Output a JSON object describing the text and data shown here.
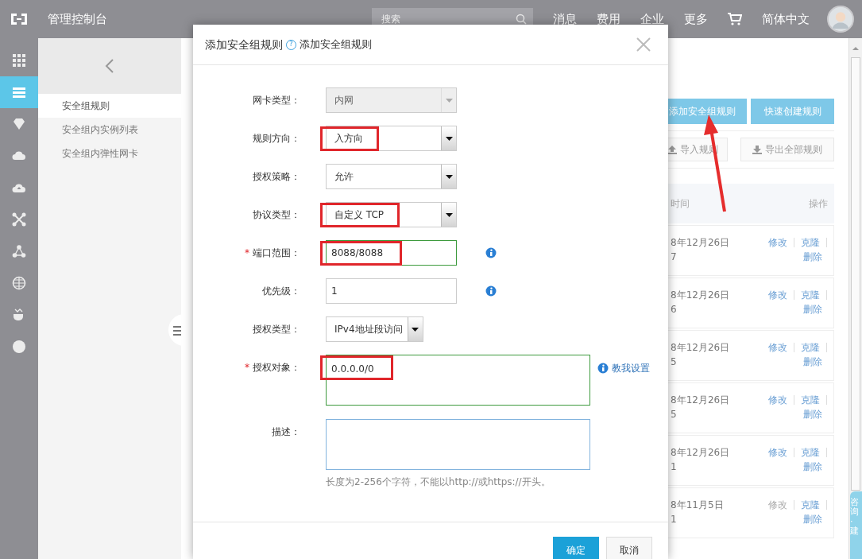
{
  "header": {
    "title": "管理控制台",
    "search": {
      "placeholder": "搜索"
    },
    "nav": [
      "消息",
      "费用",
      "企业",
      "更多"
    ],
    "language": "简体中文"
  },
  "rail": [
    {
      "selected": false
    },
    {
      "selected": true
    },
    {
      "selected": false
    },
    {
      "selected": false
    },
    {
      "selected": false
    },
    {
      "selected": false
    },
    {
      "selected": false
    },
    {
      "selected": false
    },
    {
      "selected": false
    },
    {
      "selected": false
    }
  ],
  "subnav": {
    "items": [
      {
        "label": "安全组规则",
        "selected": true
      },
      {
        "label": "安全组内实例列表",
        "selected": false
      },
      {
        "label": "安全组内弹性网卡",
        "selected": false
      }
    ]
  },
  "toolbar": {
    "primary": [
      "添加安全组规则",
      "快速创建规则"
    ],
    "secondary": [
      {
        "label": "导入规则",
        "kind": "upload"
      },
      {
        "label": "导出全部规则",
        "kind": "download"
      }
    ]
  },
  "table": {
    "columns": [
      "时间",
      "操作"
    ],
    "rows": [
      {
        "time": "8年12月26日",
        "time_2": "7",
        "actions": [
          {
            "label": "修改",
            "disabled": false
          },
          {
            "label": "克隆",
            "disabled": false
          },
          {
            "label": "删除",
            "disabled": false
          }
        ]
      },
      {
        "time": "8年12月26日",
        "time_2": "6",
        "actions": [
          {
            "label": "修改",
            "disabled": false
          },
          {
            "label": "克隆",
            "disabled": false
          },
          {
            "label": "删除",
            "disabled": false
          }
        ]
      },
      {
        "time": "8年12月26日",
        "time_2": "5",
        "actions": [
          {
            "label": "修改",
            "disabled": false
          },
          {
            "label": "克隆",
            "disabled": false
          },
          {
            "label": "删除",
            "disabled": false
          }
        ]
      },
      {
        "time": "8年12月26日",
        "time_2": "5",
        "actions": [
          {
            "label": "修改",
            "disabled": false
          },
          {
            "label": "克隆",
            "disabled": false
          },
          {
            "label": "删除",
            "disabled": false
          }
        ]
      },
      {
        "time": "8年12月26日",
        "time_2": "1",
        "actions": [
          {
            "label": "修改",
            "disabled": false
          },
          {
            "label": "克隆",
            "disabled": false
          },
          {
            "label": "删除",
            "disabled": false
          }
        ]
      },
      {
        "time": "8年11月5日",
        "time_2": "1",
        "actions": [
          {
            "label": "修改",
            "disabled": true
          },
          {
            "label": "克隆",
            "disabled": false
          },
          {
            "label": "删除",
            "disabled": false
          }
        ]
      }
    ]
  },
  "consult_tab": "咨询·建",
  "modal": {
    "title": "添加安全组规则",
    "help_icon": "?",
    "help_text": "添加安全组规则",
    "fields": [
      {
        "kind": "select",
        "label": "网卡类型：",
        "value": "内网",
        "disabled": true,
        "highlighted": false,
        "validated": false,
        "focused": false,
        "info": false
      },
      {
        "kind": "select",
        "label": "规则方向：",
        "value": "入方向",
        "disabled": false,
        "highlighted": true,
        "validated": false,
        "focused": false,
        "info": false
      },
      {
        "kind": "select",
        "label": "授权策略：",
        "value": "允许",
        "disabled": false,
        "highlighted": false,
        "validated": false,
        "focused": false,
        "info": false
      },
      {
        "kind": "select",
        "label": "协议类型：",
        "value": "自定义 TCP",
        "disabled": false,
        "highlighted": true,
        "validated": false,
        "focused": false,
        "info": false
      },
      {
        "kind": "input",
        "label": "端口范围：",
        "required_mark": "*",
        "value": "8088/8088",
        "disabled": false,
        "highlighted": true,
        "validated": true,
        "focused": false,
        "info": true
      },
      {
        "kind": "input",
        "label": "优先级：",
        "value": "1",
        "disabled": false,
        "highlighted": false,
        "validated": false,
        "focused": false,
        "info": true
      },
      {
        "kind": "auto-select",
        "label": "授权类型：",
        "value": "IPv4地址段访问",
        "disabled": false,
        "highlighted": false,
        "validated": false,
        "focused": false,
        "info": false
      },
      {
        "kind": "textarea",
        "label": "授权对象：",
        "required_mark": "*",
        "value": "0.0.0.0/0",
        "disabled": false,
        "highlighted": true,
        "validated": true,
        "focused": false,
        "info": false,
        "help_link": "教我设置"
      },
      {
        "kind": "textarea",
        "label": "描述：",
        "disabled": false,
        "highlighted": false,
        "validated": false,
        "focused": true,
        "info": false,
        "hint": "长度为2-256个字符，不能以http://或https://开头。"
      }
    ],
    "buttons": [
      {
        "label": "确定",
        "kind": "primary"
      },
      {
        "label": "取消",
        "kind": "secondary"
      }
    ]
  }
}
